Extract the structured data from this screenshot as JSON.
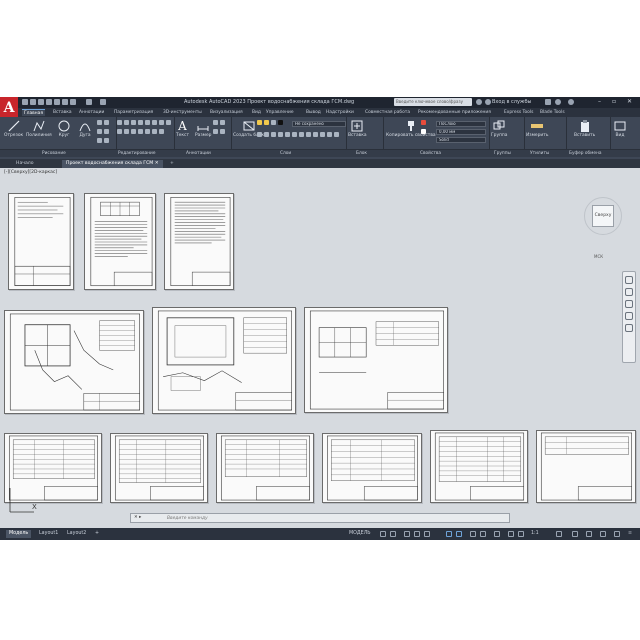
{
  "app": {
    "title": "Autodesk AutoCAD 2023   Проект водоснабжения склада ГСМ.dwg",
    "search_placeholder": "Введите ключевое слово/фразу",
    "signin": "Вход в службы",
    "logo_letter": "A"
  },
  "ribbon_tabs": [
    "Главная",
    "Вставка",
    "Аннотации",
    "Параметризация",
    "3D-инструменты",
    "Визуализация",
    "Вид",
    "Управление",
    "Вывод",
    "Надстройки",
    "Совместная работа",
    "Рекомендованные приложения",
    "Express Tools",
    "Blade Tools"
  ],
  "ribbon": {
    "draw_buttons": [
      "Отрезок",
      "Полилиния",
      "Круг",
      "Дуга"
    ],
    "text_button": "Текст",
    "dim_button": "Размер",
    "block_button": "Создать блок",
    "insert_button": "Вставка",
    "props_button": "Копировать свойства",
    "group_button": "Группа",
    "measure_button": "Измерить",
    "paste_button": "Вставить",
    "view_button": "Вид",
    "layer_state": "Не сохранено",
    "color_value": "ПоСлою",
    "lineweight_value": "0,00 мм",
    "linetype_value": "Solid",
    "panels": [
      "Рисование",
      "Редактирование",
      "Аннотации",
      "Слои",
      "Блок",
      "Свойства",
      "Группы",
      "Утилиты",
      "Буфер обмена"
    ]
  },
  "doc_tabs": [
    "Начало",
    "Проект водоснабжения склада ГСМ"
  ],
  "canvas": {
    "view_label": "[-][Сверху][2D-каркас]",
    "viewcube_label": "Сверху",
    "wcs_label": "МСК",
    "command_prompt": "Введите команду"
  },
  "status": {
    "layout_tabs": [
      "Модель",
      "Layout1",
      "Layout2"
    ],
    "model_label": "МОДЕЛЬ",
    "scale": "1:1"
  }
}
